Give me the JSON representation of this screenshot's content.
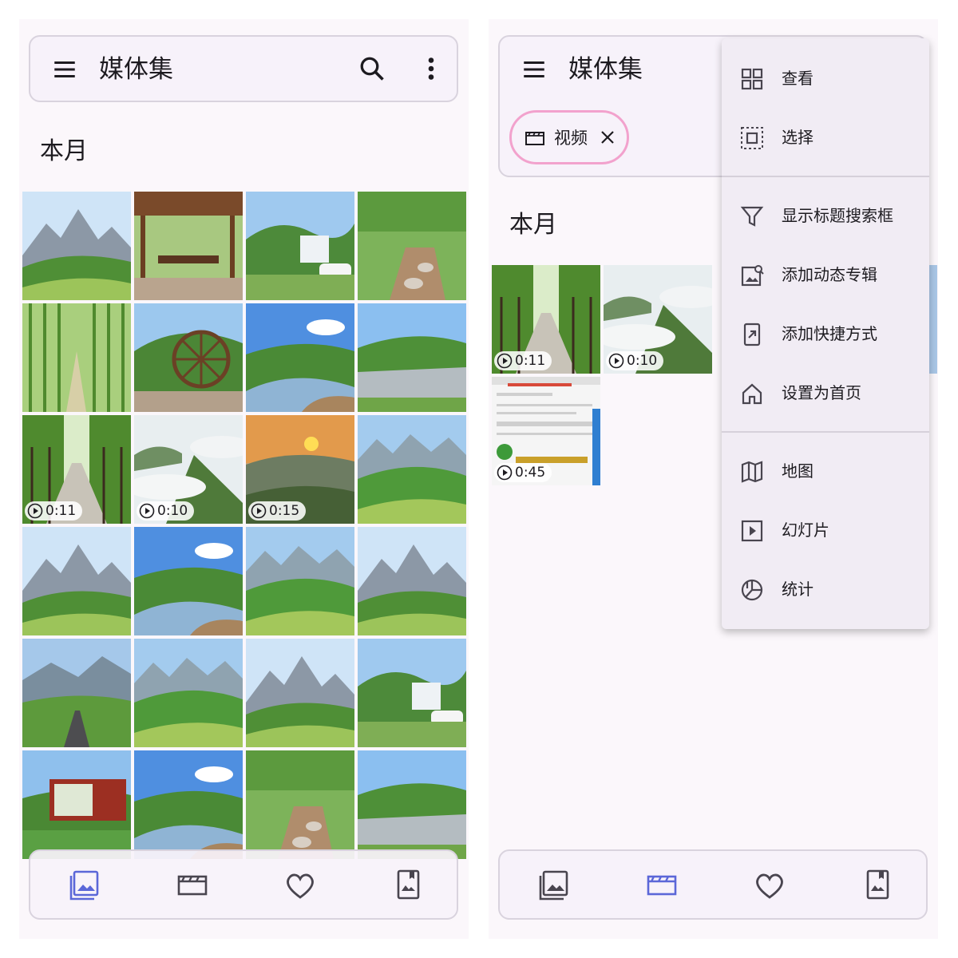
{
  "left_screen": {
    "app_bar": {
      "title": "媒体集",
      "menu_icon": "hamburger-menu-icon",
      "search_icon": "search-icon",
      "more_icon": "more-vert-icon"
    },
    "section_title": "本月",
    "tiles": [
      {
        "scene": "mountain",
        "duration": ""
      },
      {
        "scene": "pavilion",
        "duration": ""
      },
      {
        "scene": "house-car",
        "duration": ""
      },
      {
        "scene": "stream-stones",
        "duration": ""
      },
      {
        "scene": "bamboo",
        "duration": ""
      },
      {
        "scene": "waterwheel",
        "duration": ""
      },
      {
        "scene": "river-valley",
        "duration": ""
      },
      {
        "scene": "pond",
        "duration": ""
      },
      {
        "scene": "tree-road",
        "duration": "0:11"
      },
      {
        "scene": "misty-peak",
        "duration": "0:10"
      },
      {
        "scene": "sunset",
        "duration": "0:15"
      },
      {
        "scene": "green-valley",
        "duration": ""
      },
      {
        "scene": "mountain",
        "duration": ""
      },
      {
        "scene": "river-valley",
        "duration": ""
      },
      {
        "scene": "green-valley",
        "duration": ""
      },
      {
        "scene": "mountain",
        "duration": ""
      },
      {
        "scene": "valley-road",
        "duration": ""
      },
      {
        "scene": "green-valley",
        "duration": ""
      },
      {
        "scene": "mountain",
        "duration": ""
      },
      {
        "scene": "house-car",
        "duration": ""
      },
      {
        "scene": "signboard",
        "duration": ""
      },
      {
        "scene": "river-valley",
        "duration": ""
      },
      {
        "scene": "stream-stones",
        "duration": ""
      },
      {
        "scene": "pond",
        "duration": ""
      }
    ],
    "bottom_nav": [
      {
        "icon": "photos-icon",
        "selected": true
      },
      {
        "icon": "video-icon",
        "selected": false
      },
      {
        "icon": "favorite-icon",
        "selected": false
      },
      {
        "icon": "albums-icon",
        "selected": false
      }
    ]
  },
  "right_screen": {
    "app_bar": {
      "title": "媒体集"
    },
    "filter_chip": {
      "label": "视频",
      "icon": "video-icon",
      "close_icon": "close-icon"
    },
    "section_title": "本月",
    "tiles": [
      {
        "scene": "tree-road",
        "duration": "0:11"
      },
      {
        "scene": "misty-peak",
        "duration": "0:10"
      },
      {
        "scene": "screenshot",
        "duration": "0:45"
      }
    ],
    "bottom_nav": [
      {
        "icon": "photos-icon",
        "selected": false
      },
      {
        "icon": "video-icon",
        "selected": true
      },
      {
        "icon": "favorite-icon",
        "selected": false
      },
      {
        "icon": "albums-icon",
        "selected": false
      }
    ]
  },
  "overflow_menu": {
    "groups": [
      [
        {
          "label": "查看",
          "icon": "grid-view-icon"
        },
        {
          "label": "选择",
          "icon": "select-icon"
        }
      ],
      [
        {
          "label": "显示标题搜索框",
          "icon": "filter-icon"
        },
        {
          "label": "添加动态专辑",
          "icon": "dynamic-album-icon"
        },
        {
          "label": "添加快捷方式",
          "icon": "shortcut-icon"
        },
        {
          "label": "设置为首页",
          "icon": "home-icon"
        }
      ],
      [
        {
          "label": "地图",
          "icon": "map-icon"
        },
        {
          "label": "幻灯片",
          "icon": "slideshow-icon"
        },
        {
          "label": "统计",
          "icon": "stats-icon"
        }
      ]
    ]
  },
  "colors": {
    "accent": "#5b67d8",
    "chip_border": "#f2a2cd",
    "icon": "#49454f",
    "surface": "#f7f2fa"
  }
}
